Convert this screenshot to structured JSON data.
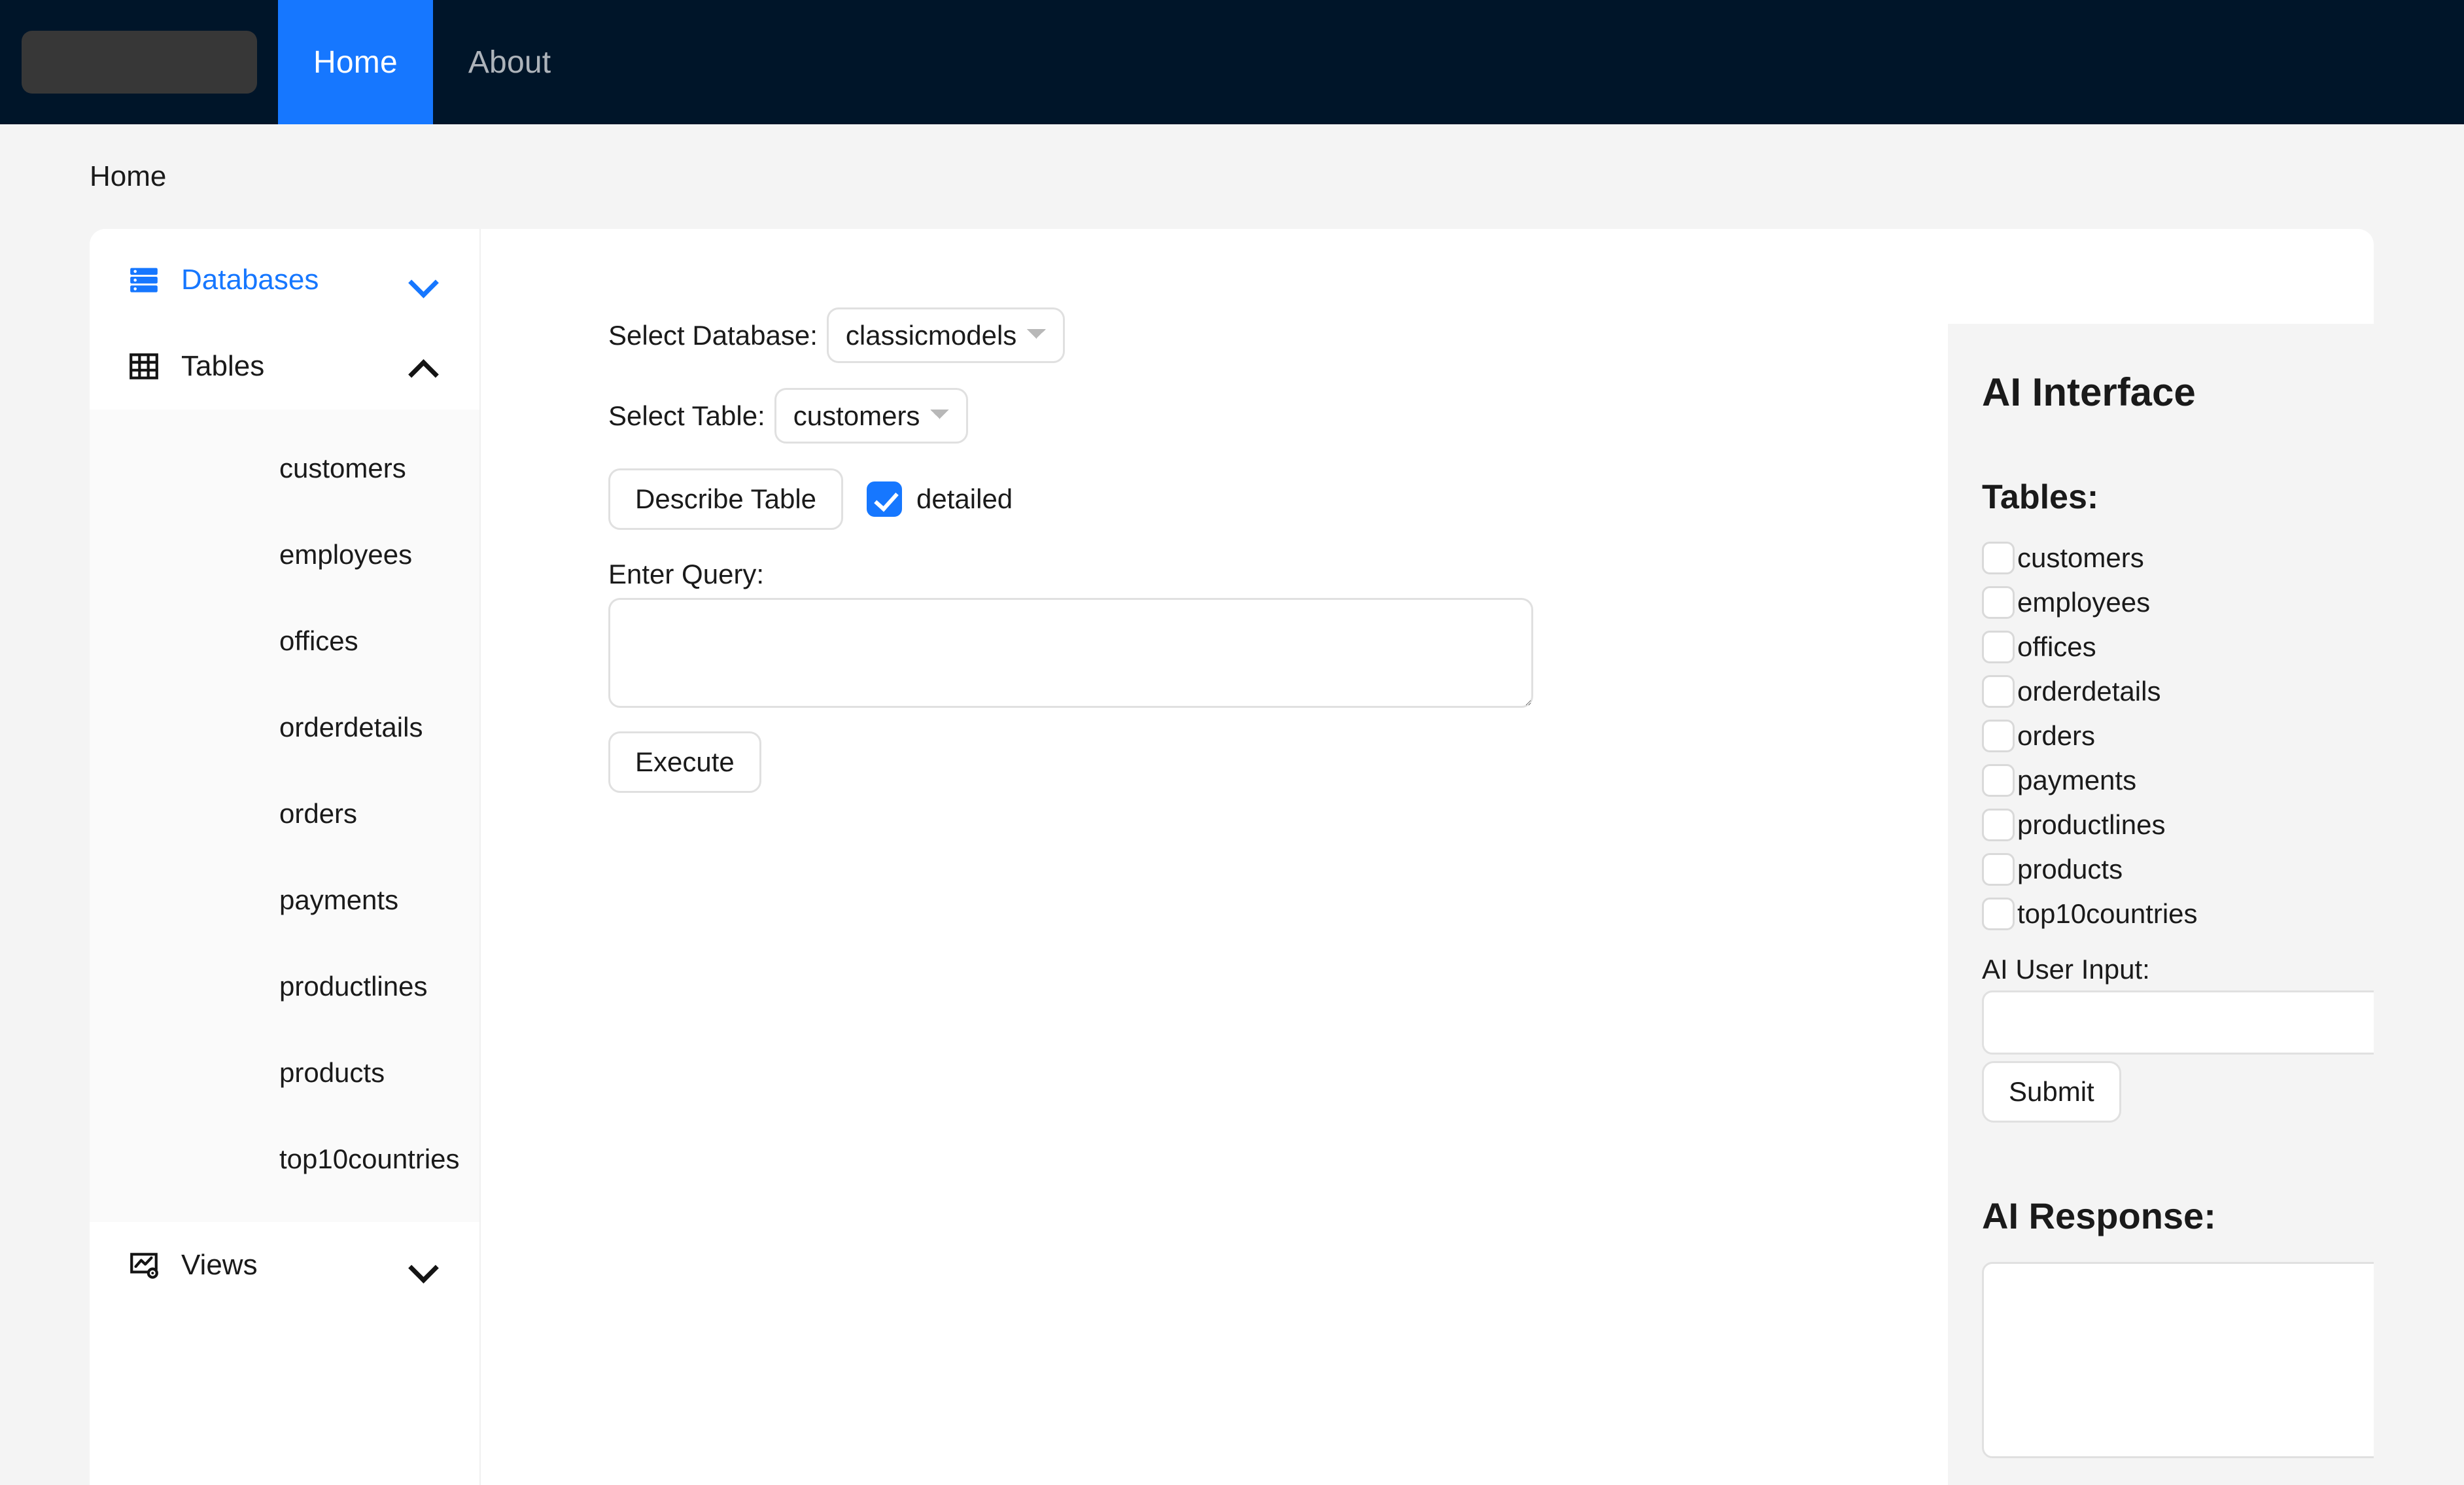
{
  "navbar": {
    "logo_placeholder": "",
    "items": [
      {
        "label": "Home",
        "active": true
      },
      {
        "label": "About",
        "active": false
      }
    ],
    "active_color": "#1677ff",
    "background_color": "#001529"
  },
  "breadcrumb": {
    "current": "Home"
  },
  "sidebar": {
    "groups": [
      {
        "label": "Databases",
        "icon": "database-icon",
        "expanded": false,
        "color": "#1677ff"
      },
      {
        "label": "Tables",
        "icon": "table-grid-icon",
        "expanded": true,
        "color": "#1a1a1a"
      },
      {
        "label": "Views",
        "icon": "views-chart-icon",
        "expanded": false,
        "color": "#1a1a1a"
      }
    ],
    "tables": [
      "customers",
      "employees",
      "offices",
      "orderdetails",
      "orders",
      "payments",
      "productlines",
      "products",
      "top10countries"
    ]
  },
  "main": {
    "database_label": "Select Database:",
    "database_value": "classicmodels",
    "database_options": [
      "classicmodels"
    ],
    "table_label": "Select Table:",
    "table_value": "customers",
    "table_options": [
      "customers"
    ],
    "describe_button": "Describe Table",
    "detailed_label": "detailed",
    "detailed_checked": true,
    "query_label": "Enter Query:",
    "query_value": "",
    "query_placeholder": "",
    "execute_button": "Execute"
  },
  "ai_panel": {
    "title": "AI Interface",
    "tables_heading": "Tables:",
    "tables": [
      {
        "label": "customers",
        "checked": false
      },
      {
        "label": "employees",
        "checked": false
      },
      {
        "label": "offices",
        "checked": false
      },
      {
        "label": "orderdetails",
        "checked": false
      },
      {
        "label": "orders",
        "checked": false
      },
      {
        "label": "payments",
        "checked": false
      },
      {
        "label": "productlines",
        "checked": false
      },
      {
        "label": "products",
        "checked": false
      },
      {
        "label": "top10countries",
        "checked": false
      }
    ],
    "user_input_label": "AI User Input:",
    "user_input_value": "",
    "user_input_placeholder": "",
    "submit_button": "Submit",
    "response_label": "AI Response:",
    "response_value": "",
    "response_placeholder": ""
  }
}
